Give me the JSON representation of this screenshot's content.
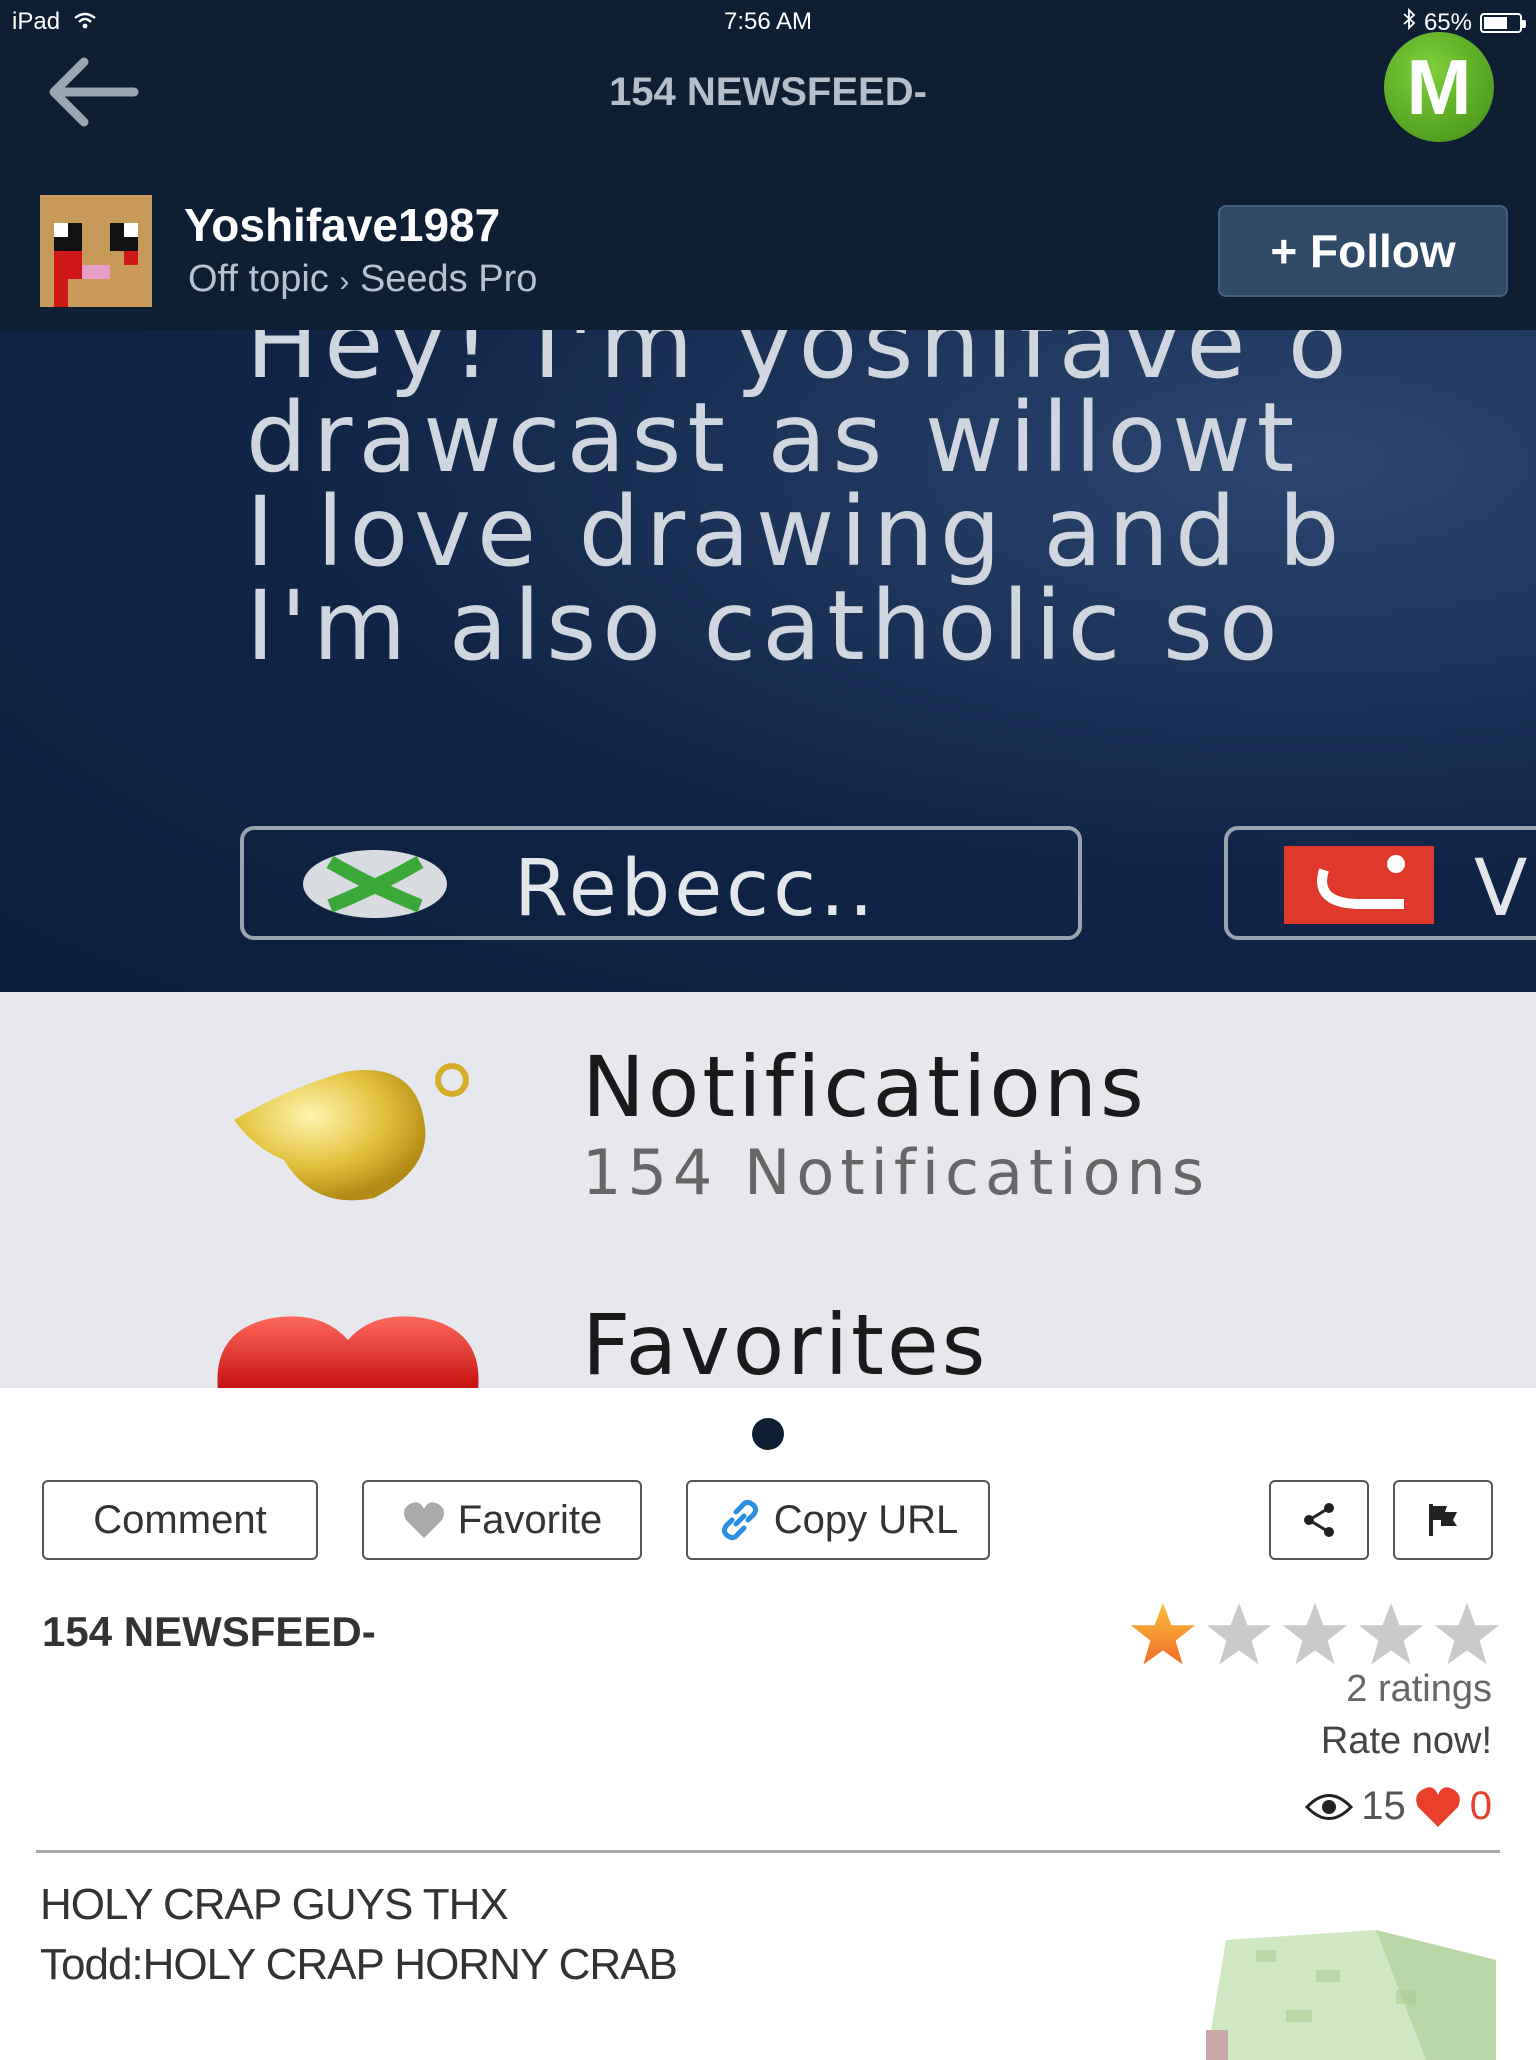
{
  "status_bar": {
    "device": "iPad",
    "time": "7:56 AM",
    "battery": "65%"
  },
  "nav": {
    "title": "154 NEWSFEED-",
    "logo_letter": "M"
  },
  "author": {
    "username": "Yoshifave1987",
    "category": "Off topic",
    "separator": "›",
    "subcategory": "Seeds Pro",
    "follow_label": "+ Follow"
  },
  "screenshot": {
    "lines": [
      "Hey! I'm yoshifave o",
      "drawcast as willowt",
      "I love drawing and b",
      "I'm also catholic so"
    ],
    "gamer_button": "Rebecc..",
    "second_button_initial": "V",
    "notifications_title": "Notifications",
    "notifications_sub": "154 Notifications",
    "favorites_title": "Favorites"
  },
  "actions": {
    "comment": "Comment",
    "favorite": "Favorite",
    "copy_url": "Copy URL"
  },
  "post": {
    "title": "154 NEWSFEED-",
    "rating": 1,
    "rating_max": 5,
    "ratings_count": "2 ratings",
    "rate_now": "Rate now!",
    "views": "15",
    "likes": "0",
    "body_lines": [
      "HOLY CRAP GUYS THX",
      "Todd:HOLY CRAP HORNY CRAB"
    ]
  },
  "colors": {
    "header_bg": "#0e1e33",
    "accent_green": "#5cb52a",
    "like_red": "#e8402a",
    "star_gold": "#f5a623"
  }
}
